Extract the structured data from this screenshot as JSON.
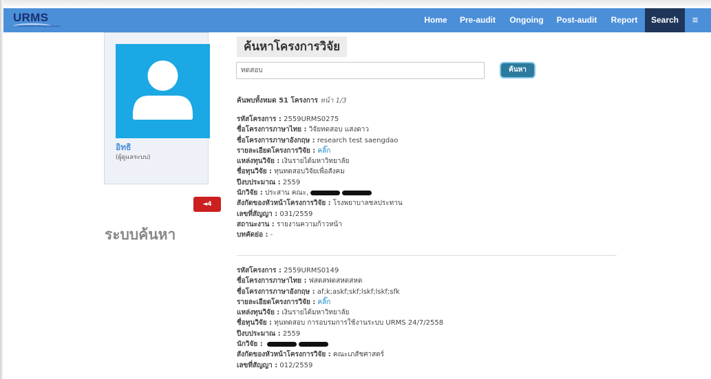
{
  "brand": {
    "name": "URMS",
    "tagline": "University Research Management System"
  },
  "nav": {
    "items": [
      {
        "label": "Home"
      },
      {
        "label": "Pre-audit"
      },
      {
        "label": "Ongoing"
      },
      {
        "label": "Post-audit"
      },
      {
        "label": "Report"
      },
      {
        "label": "Search"
      }
    ],
    "menu_icon": "≡"
  },
  "profile": {
    "name": "อิทธิ",
    "role": "(ผู้ดูแลระบบ)",
    "notifications": "4"
  },
  "side_label": "ระบบค้นหา",
  "page_title": "ค้นหาโครงการวิจัย",
  "search": {
    "value": "ทดสอบ",
    "button": "ค้นหา"
  },
  "summary": {
    "text": "ค้นพบทั้งหมด 51 โครงการ",
    "page": "หน้า 1/3"
  },
  "labels": {
    "code": "รหัสโครงการ :",
    "name_th": "ชื่อโครงการภาษาไทย :",
    "name_en": "ชื่อโครงการภาษาอังกฤษ :",
    "detail": "รายละเอียดโครงการวิจัย :",
    "fund_src": "แหล่งทุนวิจัย :",
    "fund_name": "ชื่อทุนวิจัย :",
    "year": "ปีงบประมาณ :",
    "researcher": "นักวิจัย :",
    "affil": "สังกัดของหัวหน้าโครงการวิจัย :",
    "contract": "เลขที่สัญญา :",
    "status": "สถานะงาน :",
    "abstract": "บทคัดย่อ :"
  },
  "records": [
    {
      "code": "2559URMS0275",
      "name_th": "วิจัยทดสอบ แสงดาว",
      "name_en": "research test saengdao",
      "detail": "คลิ๊ก",
      "fund_src": "เงินรายได้มหาวิทยาลัย",
      "fund_name": "ทุนทดสอบวิจัยเพื่อสังคม",
      "year": "2559",
      "researcher": "ประสาน คณะ,",
      "affil": "โรงพยาบาลชลประทาน",
      "contract": "031/2559",
      "status": "รายงานความก้าวหน้า",
      "abstract": "-"
    },
    {
      "code": "2559URMS0149",
      "name_th": "ฟสดสฟดสหดสหด",
      "name_en": "af;k;askf;skf;lskf;lskf;sfk",
      "detail": "คลิ๊ก",
      "fund_src": "เงินรายได้มหาวิทยาลัย",
      "fund_name": "ทุนทดสอบ การอบรมการใช้งานระบบ URMS 24/7/2558",
      "year": "2559",
      "researcher": "",
      "affil": "คณะเภสัชศาสตร์",
      "contract": "012/2559"
    }
  ],
  "colors": {
    "navbar": "#4b8fd9",
    "nav_active": "#1f3559",
    "avatar": "#1ba8e4",
    "badge": "#cc1f1f",
    "link": "#1a8acb"
  }
}
